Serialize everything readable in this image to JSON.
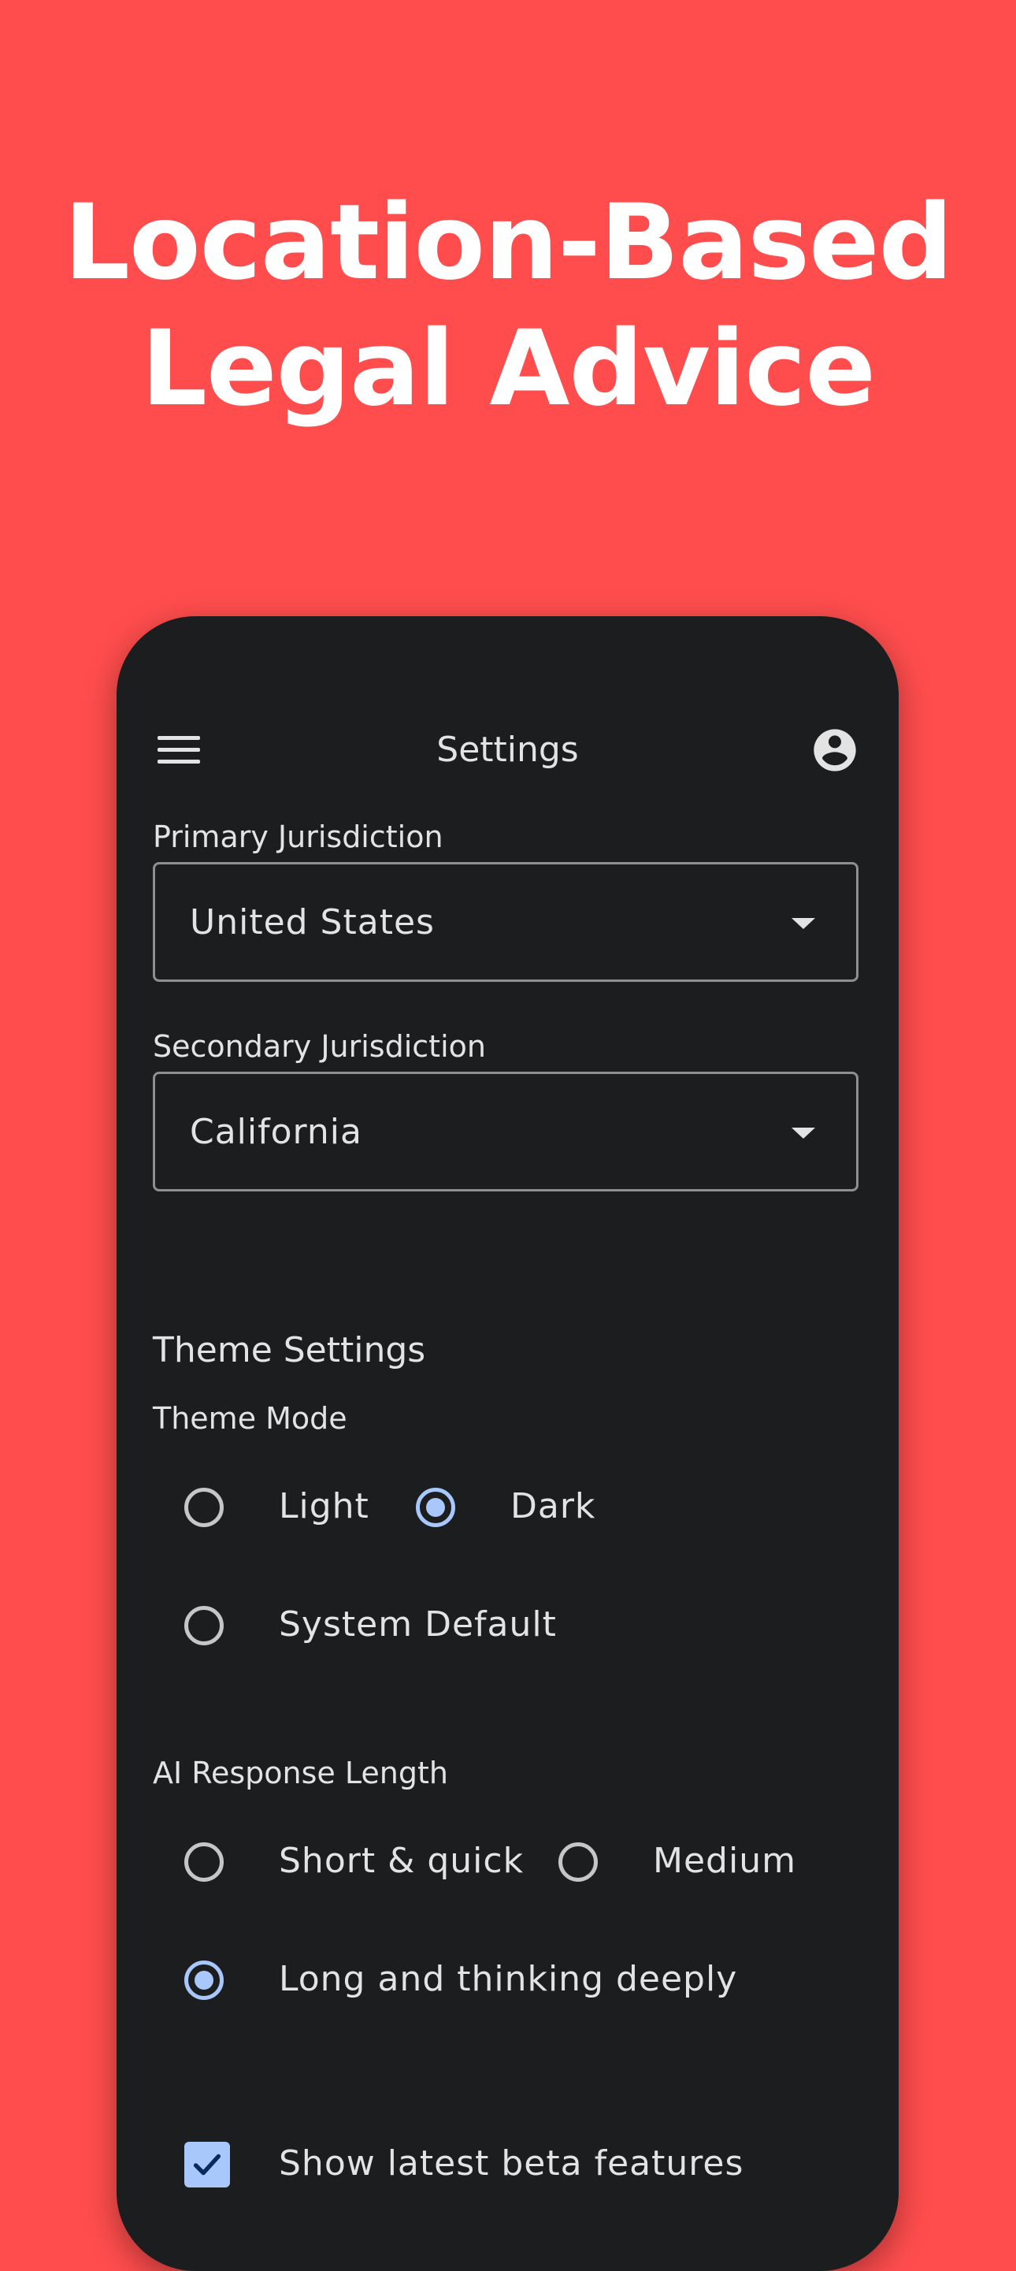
{
  "colors": {
    "background": "#ff4d4d",
    "phone_surface": "#1c1d1f",
    "text": "#e3e3e3",
    "accent": "#a8c7fa",
    "outline": "#8f8f92"
  },
  "headline": {
    "line1": "Location-Based",
    "line2": "Legal Advice"
  },
  "appbar": {
    "menu_icon": "hamburger-menu-icon",
    "title": "Settings",
    "account_icon": "account-circle-icon"
  },
  "jurisdiction": {
    "primary_label": "Primary Jurisdiction",
    "primary_value": "United States",
    "secondary_label": "Secondary Jurisdiction",
    "secondary_value": "California"
  },
  "theme": {
    "heading": "Theme Settings",
    "mode_label": "Theme Mode",
    "options": [
      "Light",
      "Dark",
      "System Default"
    ],
    "selected": "Dark"
  },
  "ai_response": {
    "label": "AI Response Length",
    "options": [
      "Short & quick",
      "Medium",
      "Long and thinking deeply"
    ],
    "selected": "Long and thinking deeply"
  },
  "beta": {
    "label": "Show latest beta features",
    "checked": true
  }
}
